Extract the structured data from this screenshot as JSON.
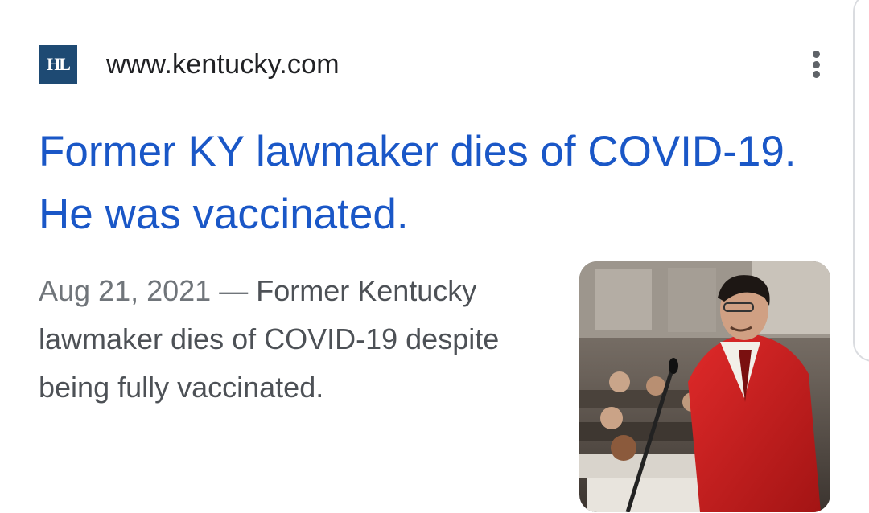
{
  "source": {
    "favicon_text": "HL",
    "favicon_color": "#1e4a73",
    "url": "www.kentucky.com"
  },
  "more_menu": {
    "icon": "more-vert-icon"
  },
  "headline": "Former KY lawmaker dies of COVID-19. He was vaccinated.",
  "snippet": {
    "date": "Aug 21, 2021",
    "separator": " — ",
    "text": "Former Kentucky lawmaker dies of COVID-19 despite being fully vaccinated."
  },
  "thumbnail": {
    "subject": "lawmaker-in-red-jacket-speaking-at-microphone"
  },
  "colors": {
    "headline": "#1a57c7",
    "url": "#202124",
    "snippet": "#4d5156",
    "date": "#70757a"
  }
}
